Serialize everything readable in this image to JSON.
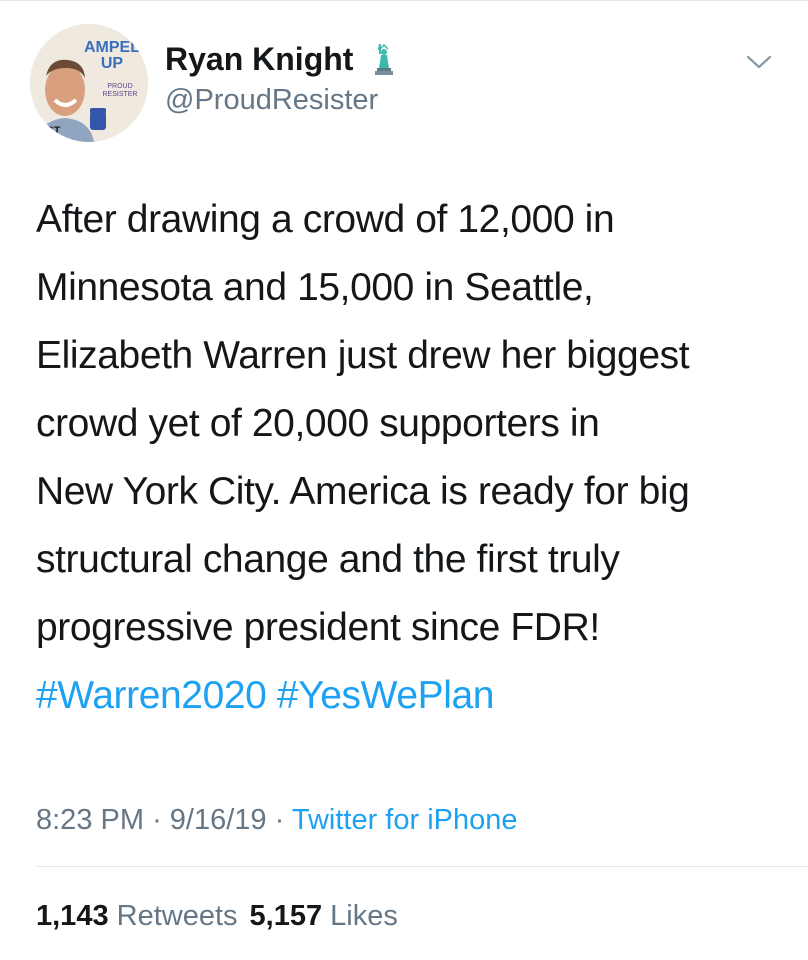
{
  "tweet": {
    "author": {
      "display_name": "Ryan Knight",
      "handle": "@ProudResister",
      "verified_icon": "statue-of-liberty-icon",
      "avatar_text": {
        "line1": "AMPEL",
        "line2": "UP",
        "small1": "PROUD",
        "small2": "RESISTER",
        "side": "SIST"
      }
    },
    "text_lines": [
      "After drawing a crowd of 12,000 in",
      "Minnesota and 15,000 in Seattle,",
      "Elizabeth Warren just drew her biggest",
      "crowd yet of 20,000 supporters in",
      "New York City. America is ready for big",
      "structural change and the first truly",
      "progressive president since FDR!"
    ],
    "hashtags": [
      "#Warren2020",
      "#YesWePlan"
    ],
    "time": "8:23 PM",
    "date": "9/16/19",
    "separator": "·",
    "source": "Twitter for iPhone",
    "retweets": {
      "count": "1,143",
      "label": "Retweets"
    },
    "likes": {
      "count": "5,157",
      "label": "Likes"
    }
  },
  "colors": {
    "link": "#1da1f2",
    "secondary": "#657786",
    "primary": "#14171a",
    "divider": "#e1e8ed"
  }
}
